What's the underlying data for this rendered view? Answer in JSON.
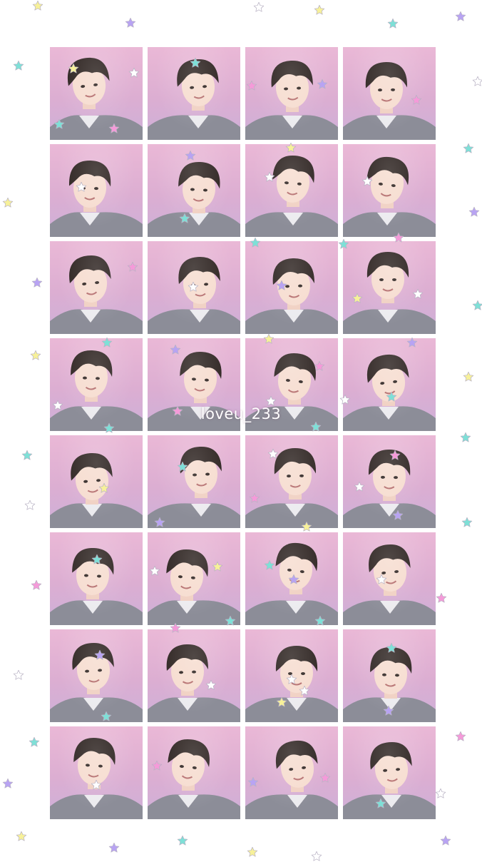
{
  "wallpaper": {
    "watermark_text": "loveu_233",
    "rows": 8,
    "columns": 4,
    "photo_background": "#e3b3d5",
    "star_colors": {
      "yellow": "#f7f199",
      "teal": "#7ee0d7",
      "lavender": "#b8a3f3",
      "pink": "#f59ad9",
      "white": "#ffffff",
      "blue": "#8edcf1"
    }
  }
}
